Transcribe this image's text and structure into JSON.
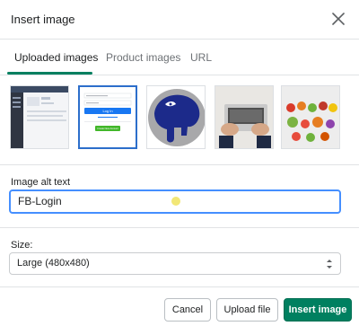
{
  "dialog": {
    "title": "Insert image"
  },
  "tabs": [
    {
      "label": "Uploaded images",
      "active": true
    },
    {
      "label": "Product images",
      "active": false
    },
    {
      "label": "URL",
      "active": false
    }
  ],
  "images": [
    {
      "name": "fb-dashboard-screenshot",
      "selected": false
    },
    {
      "name": "fb-login-screenshot",
      "selected": true,
      "button_text": "Log In",
      "create_text": "Create New Account"
    },
    {
      "name": "elephant-logo",
      "selected": false
    },
    {
      "name": "hands-on-laptop",
      "selected": false
    },
    {
      "name": "vegetables-on-table",
      "selected": false
    }
  ],
  "alt_text": {
    "label": "Image alt text",
    "value": "FB-Login"
  },
  "size": {
    "label": "Size:",
    "selected": "Large (480x480)"
  },
  "buttons": {
    "cancel": "Cancel",
    "upload": "Upload file",
    "insert": "Insert image"
  },
  "colors": {
    "primary": "#008060",
    "focus": "#458fff",
    "selected_border": "#2c6ecb"
  }
}
